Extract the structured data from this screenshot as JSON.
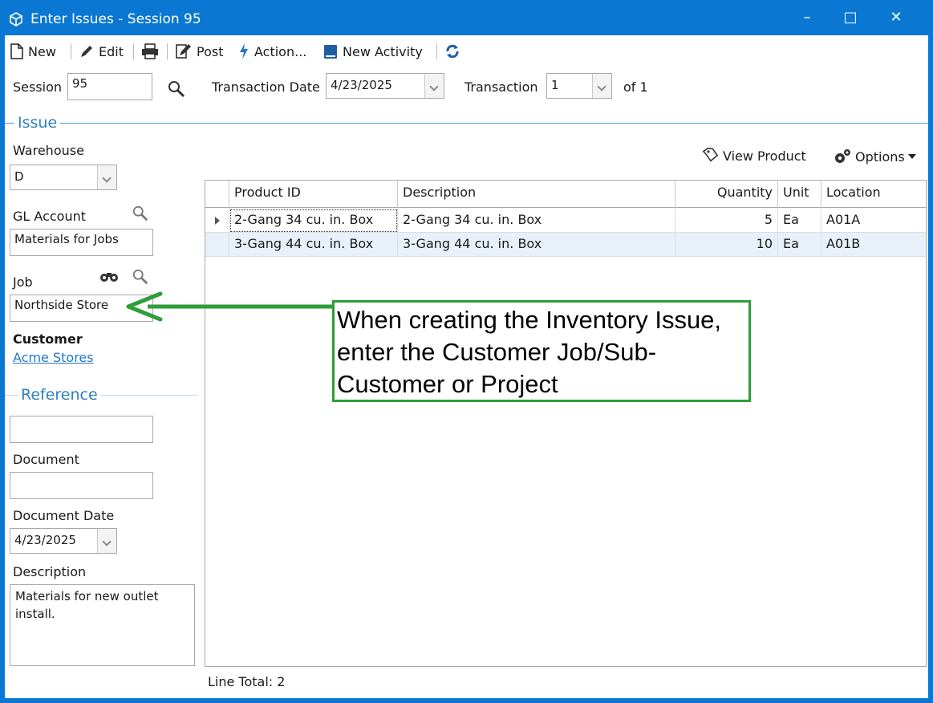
{
  "window": {
    "title": "Enter Issues - Session 95",
    "minimize": "–",
    "maximize": "□",
    "close": "✕"
  },
  "toolbar": {
    "new": "New",
    "edit": "Edit",
    "post": "Post",
    "action": "Action...",
    "new_activity": "New Activity"
  },
  "header": {
    "session_label": "Session",
    "session_value": "95",
    "transaction_date_label": "Transaction Date",
    "transaction_date_value": "4/23/2025",
    "transaction_label": "Transaction",
    "transaction_value": "1",
    "of_text": "of 1"
  },
  "issue": {
    "section_title": "Issue",
    "warehouse_label": "Warehouse",
    "warehouse_value": "D",
    "gl_account_label": "GL Account",
    "gl_account_value": "Materials for Jobs",
    "job_label": "Job",
    "job_value": "Northside Store",
    "customer_label": "Customer",
    "customer_value": "Acme Stores"
  },
  "reference": {
    "section_title": "Reference",
    "reference_value": "",
    "document_label": "Document",
    "document_value": "",
    "document_date_label": "Document Date",
    "document_date_value": "4/23/2025",
    "description_label": "Description",
    "description_value": "Materials for new outlet install."
  },
  "grid_toolbar": {
    "view_product": "View Product",
    "options": "Options"
  },
  "grid": {
    "headers": {
      "product_id": "Product ID",
      "description": "Description",
      "quantity": "Quantity",
      "unit": "Unit",
      "location": "Location"
    },
    "rows": [
      {
        "product_id": "2-Gang 34 cu. in. Box",
        "description": "2-Gang 34 cu. in. Box",
        "quantity": "5",
        "unit": "Ea",
        "location": "A01A"
      },
      {
        "product_id": "3-Gang 44 cu. in. Box",
        "description": "3-Gang 44 cu. in. Box",
        "quantity": "10",
        "unit": "Ea",
        "location": "A01B"
      }
    ],
    "line_total": "Line Total: 2"
  },
  "annotation": {
    "text": "When creating the Inventory Issue, enter the Customer Job/Sub-Customer or Project",
    "color": "#2e9e3a"
  }
}
